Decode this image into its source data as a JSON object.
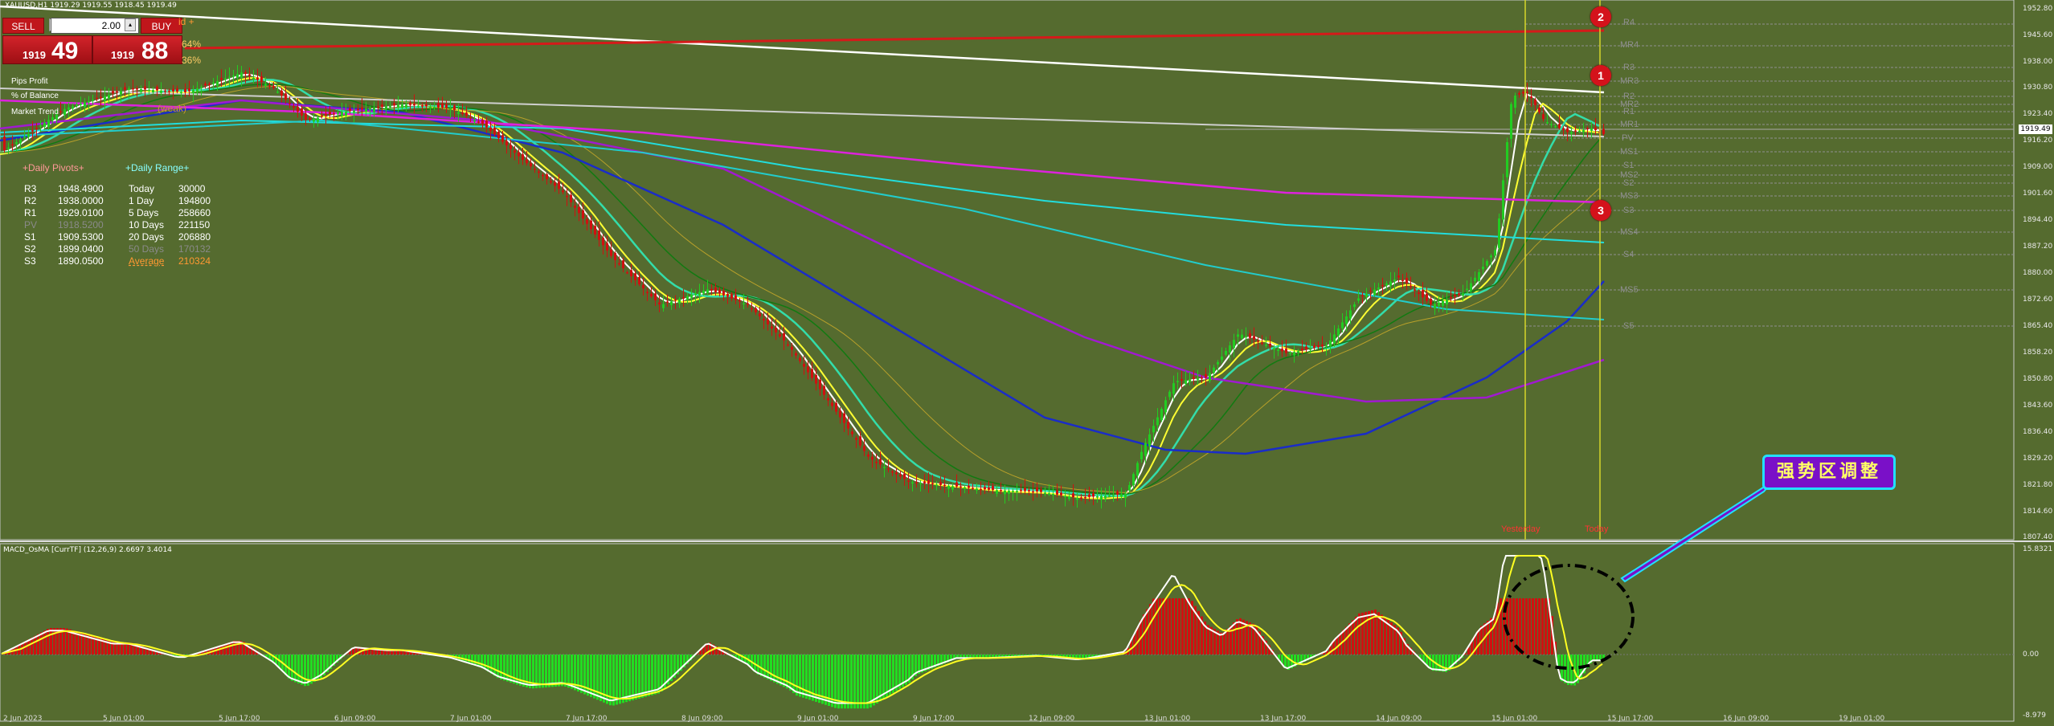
{
  "window": {
    "title_line": "XAUUSD,H1  1919.29 1919.55 1918.45 1919.49"
  },
  "trade_panel": {
    "sell_label": "SELL",
    "buy_label": "BUY",
    "lots_value": "2.00",
    "bid_small": "1919",
    "bid_big": "49",
    "ask_small": "1919",
    "ask_big": "88",
    "pct1": "64%",
    "pct2": "36%",
    "right_tag": "id  +"
  },
  "info": {
    "pips_profit": "Pips Profit",
    "pct_balance": "% of Balance",
    "market_state": "Market Trend",
    "weak": "(weak)"
  },
  "daily_pivots": {
    "header": "+Daily Pivots+",
    "rows": [
      {
        "label": "R3",
        "value": "1948.4900"
      },
      {
        "label": "R2",
        "value": "1938.0000"
      },
      {
        "label": "R1",
        "value": "1929.0100"
      },
      {
        "label": "PV",
        "value": "1918.5200"
      },
      {
        "label": "S1",
        "value": "1909.5300"
      },
      {
        "label": "S2",
        "value": "1899.0400"
      },
      {
        "label": "S3",
        "value": "1890.0500"
      }
    ]
  },
  "daily_range": {
    "header": "+Daily Range+",
    "rows": [
      {
        "label": "Today",
        "value": "30000"
      },
      {
        "label": "1 Day",
        "value": "194800"
      },
      {
        "label": "5 Days",
        "value": "258660"
      },
      {
        "label": "10 Days",
        "value": "221150"
      },
      {
        "label": "20 Days",
        "value": "206880"
      },
      {
        "label": "50 Days",
        "value": "170132"
      },
      {
        "label": "Average",
        "value": "210324"
      }
    ]
  },
  "price_axis": [
    "1952.80",
    "1945.60",
    "1938.00",
    "1930.80",
    "1923.40",
    "1916.20",
    "1909.00",
    "1901.60",
    "1894.40",
    "1887.20",
    "1880.00",
    "1872.60",
    "1865.40",
    "1858.20",
    "1850.80",
    "1843.60",
    "1836.40",
    "1829.20",
    "1821.80",
    "1814.60",
    "1807.40"
  ],
  "current_price": "1919.49",
  "pivot_levels": [
    "R4",
    "MR4",
    "R3",
    "MR3",
    "R2",
    "MR2",
    "R1",
    "MR1",
    "PV",
    "MS1",
    "S1",
    "MS2",
    "S2",
    "MS3",
    "S3",
    "MS4",
    "S4",
    "MS5",
    "S5"
  ],
  "markers": [
    "2",
    "1",
    "3"
  ],
  "vlines": [
    "Yesterday",
    "Today"
  ],
  "macd": {
    "label": "MACD_OsMA [CurrTF] (12,26,9) 2.6697 3.4014",
    "axis": [
      "15.8321",
      "0.00",
      "-8.979"
    ]
  },
  "callout": "强势区调整",
  "x_axis": [
    "2 Jun 2023",
    "5 Jun 01:00",
    "5 Jun 17:00",
    "6 Jun 09:00",
    "7 Jun 01:00",
    "7 Jun 17:00",
    "8 Jun 09:00",
    "9 Jun 01:00",
    "9 Jun 17:00",
    "12 Jun 09:00",
    "13 Jun 01:00",
    "13 Jun 17:00",
    "14 Jun 09:00",
    "15 Jun 01:00",
    "15 Jun 17:00",
    "16 Jun 09:00",
    "19 Jun 01:00"
  ],
  "colors": {
    "background": "#556b2f",
    "candle_up": "#22cc22",
    "candle_down": "#d01010",
    "pivot_line": "#8f8f8f",
    "callout_bg": "#7a10c8",
    "callout_border": "#22e0ff"
  }
}
